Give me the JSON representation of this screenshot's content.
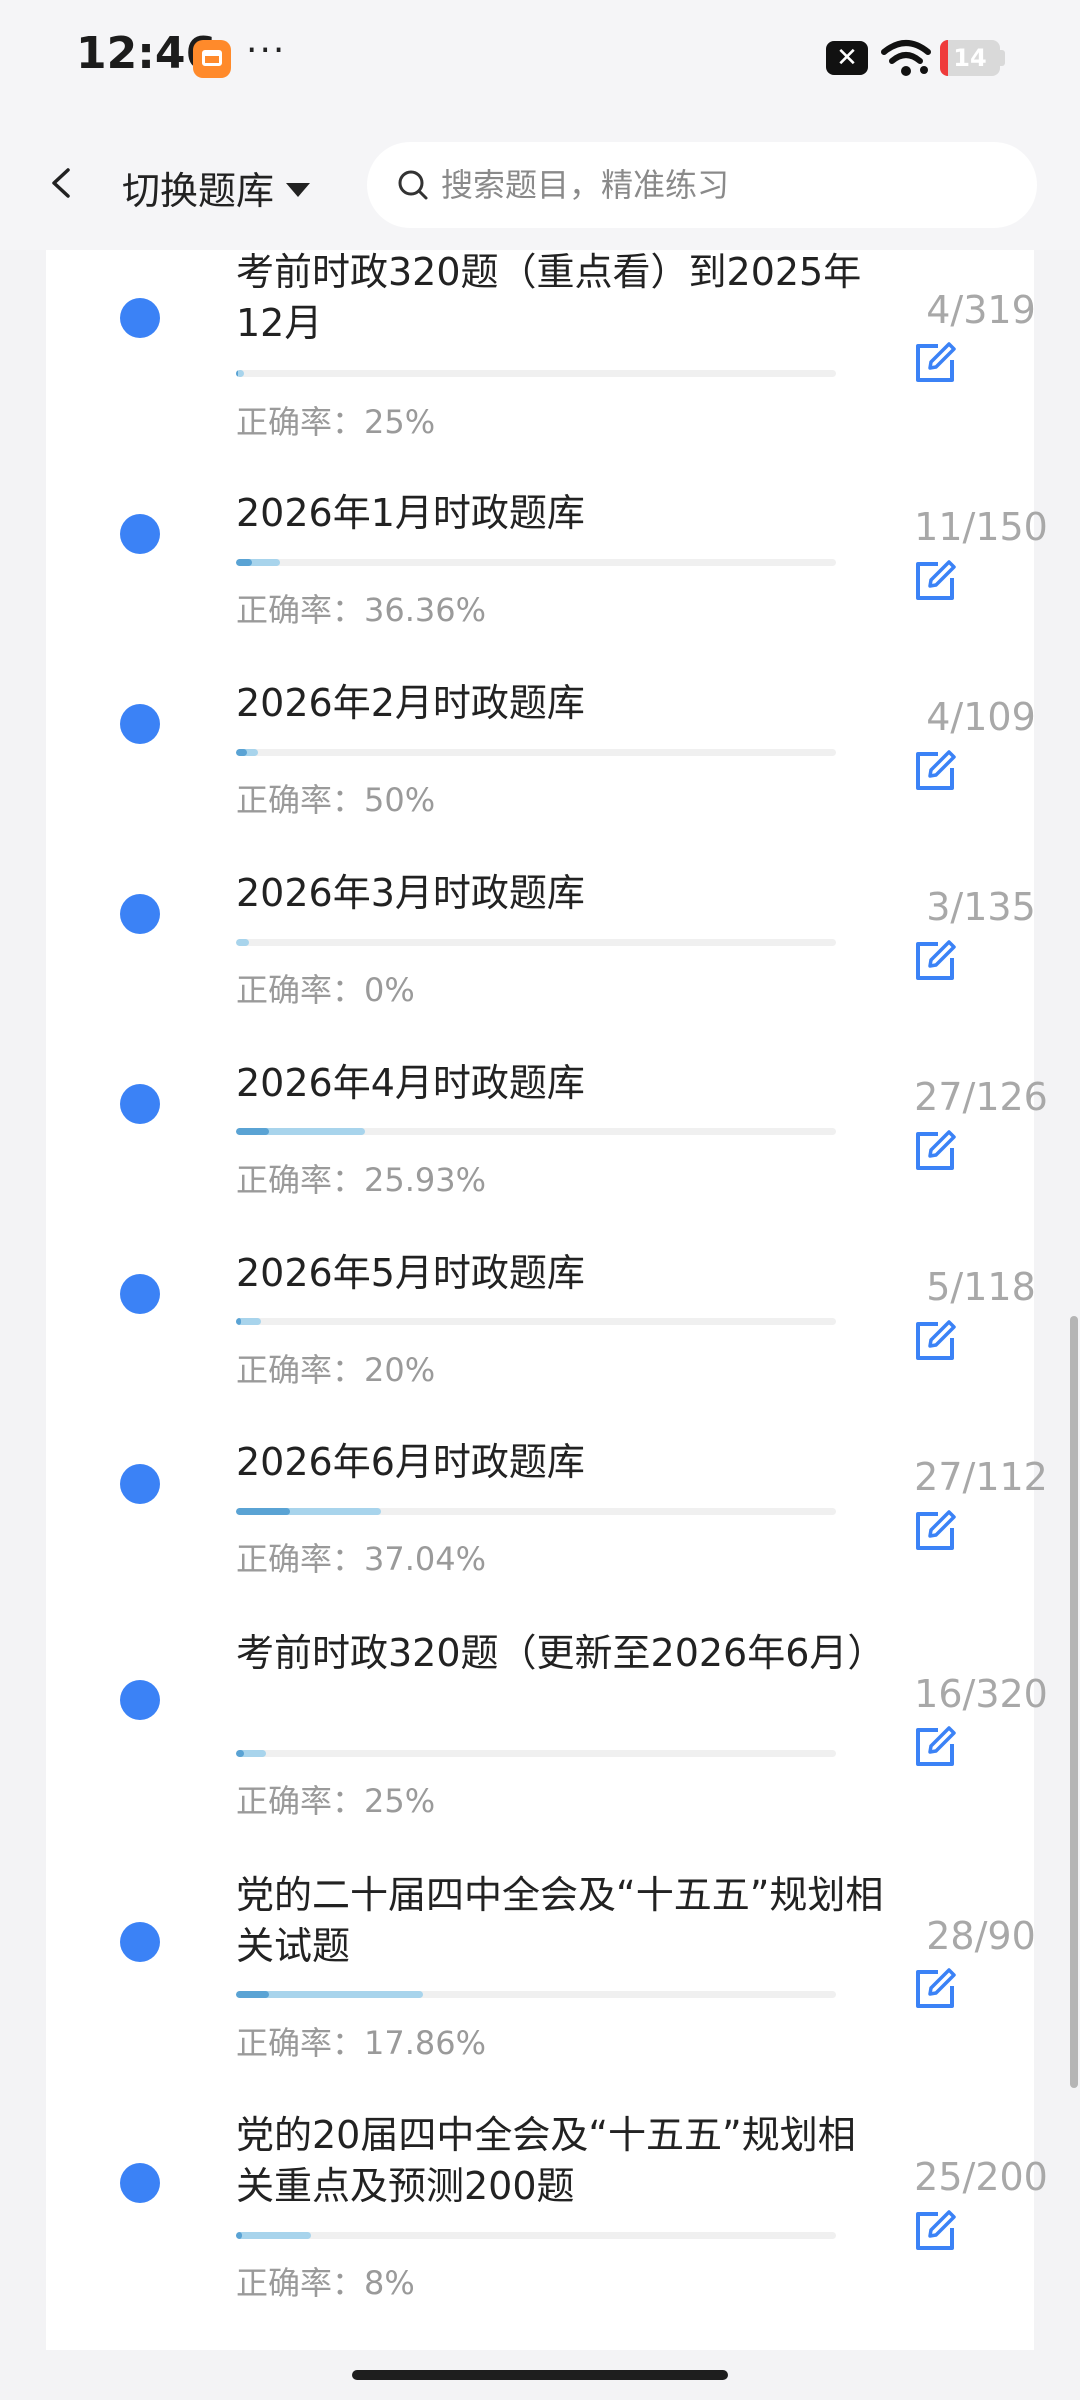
{
  "status_bar": {
    "time": "12:46",
    "more": "···",
    "battery_level": "14",
    "icons": [
      "app-badge-icon",
      "close-status-icon",
      "wifi-icon",
      "battery-icon"
    ]
  },
  "header": {
    "back_icon": "chevron-left-icon",
    "switch_bank_label": "切换题库",
    "search_placeholder": "搜索题目，精准练习"
  },
  "colors": {
    "accent": "#3b82f6",
    "progress_answered": "#a8d4ec",
    "progress_correct": "#5aa3d4",
    "muted_text": "#9a9a9a"
  },
  "list": {
    "items": [
      {
        "title": "考前时政320题（重点看）到2025年12月",
        "count": "4/319",
        "accuracy": "正确率：25%",
        "answered_fraction": 0.0125,
        "correct_fraction": 0.003
      },
      {
        "title": "2026年1月时政题库",
        "count": "11/150",
        "accuracy": "正确率：36.36%",
        "answered_fraction": 0.0733,
        "correct_fraction": 0.0267
      },
      {
        "title": "2026年2月时政题库",
        "count": "4/109",
        "accuracy": "正确率：50%",
        "answered_fraction": 0.0367,
        "correct_fraction": 0.0183
      },
      {
        "title": "2026年3月时政题库",
        "count": "3/135",
        "accuracy": "正确率：0%",
        "answered_fraction": 0.0222,
        "correct_fraction": 0
      },
      {
        "title": "2026年4月时政题库",
        "count": "27/126",
        "accuracy": "正确率：25.93%",
        "answered_fraction": 0.2143,
        "correct_fraction": 0.0556
      },
      {
        "title": "2026年5月时政题库",
        "count": "5/118",
        "accuracy": "正确率：20%",
        "answered_fraction": 0.0424,
        "correct_fraction": 0.0085
      },
      {
        "title": "2026年6月时政题库",
        "count": "27/112",
        "accuracy": "正确率：37.04%",
        "answered_fraction": 0.2411,
        "correct_fraction": 0.0893
      },
      {
        "title": "考前时政320题（更新至2026年6月）",
        "count": "16/320",
        "accuracy": "正确率：25%",
        "answered_fraction": 0.05,
        "correct_fraction": 0.0125
      },
      {
        "title": "党的二十届四中全会及“十五五”规划相关试题",
        "count": "28/90",
        "accuracy": "正确率：17.86%",
        "answered_fraction": 0.3111,
        "correct_fraction": 0.0556
      },
      {
        "title": "党的20届四中全会及“十五五”规划相关重点及预测200题",
        "count": "25/200",
        "accuracy": "正确率：8%",
        "answered_fraction": 0.125,
        "correct_fraction": 0.01
      }
    ]
  }
}
